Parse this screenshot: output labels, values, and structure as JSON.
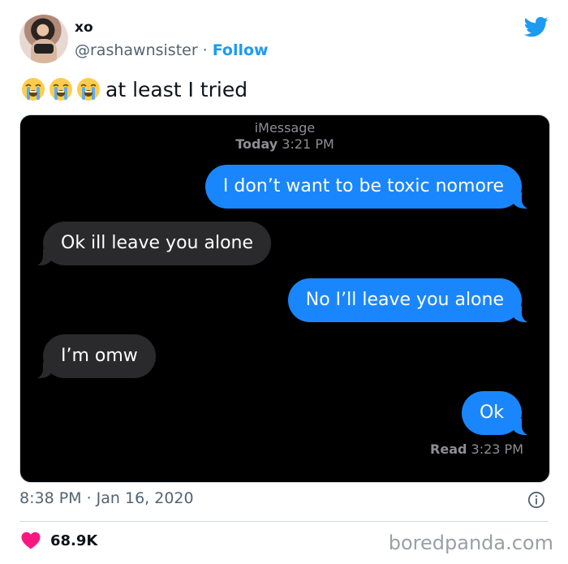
{
  "author": {
    "name": "xo",
    "handle": "@rashawnsister",
    "separator": "·",
    "follow_label": "Follow"
  },
  "tweet": {
    "emoji": [
      "loudly-crying-face-emoji",
      "loudly-crying-face-emoji",
      "loudly-crying-face-emoji"
    ],
    "text": "at least I tried"
  },
  "imessage": {
    "service": "iMessage",
    "date_label": "Today",
    "time": "3:21 PM",
    "messages": [
      {
        "from": "me",
        "text": "I don’t want to be toxic nomore"
      },
      {
        "from": "them",
        "text": "Ok ill leave you alone"
      },
      {
        "from": "me",
        "text": "No I’ll leave you alone"
      },
      {
        "from": "them",
        "text": "I’m omw"
      },
      {
        "from": "me",
        "text": "Ok"
      }
    ],
    "read_label": "Read",
    "read_time": "3:23 PM"
  },
  "footer": {
    "timestamp": "8:38 PM · Jan 16, 2020",
    "likes": "68.9K",
    "watermark": "boredpanda.com"
  },
  "colors": {
    "twitter_blue": "#1d9bf0",
    "imessage_blue": "#1a86fd",
    "received_gray": "#2a2a2c",
    "heart_pink": "#f91880"
  },
  "icons": [
    "twitter-logo-icon",
    "info-icon",
    "heart-icon"
  ]
}
